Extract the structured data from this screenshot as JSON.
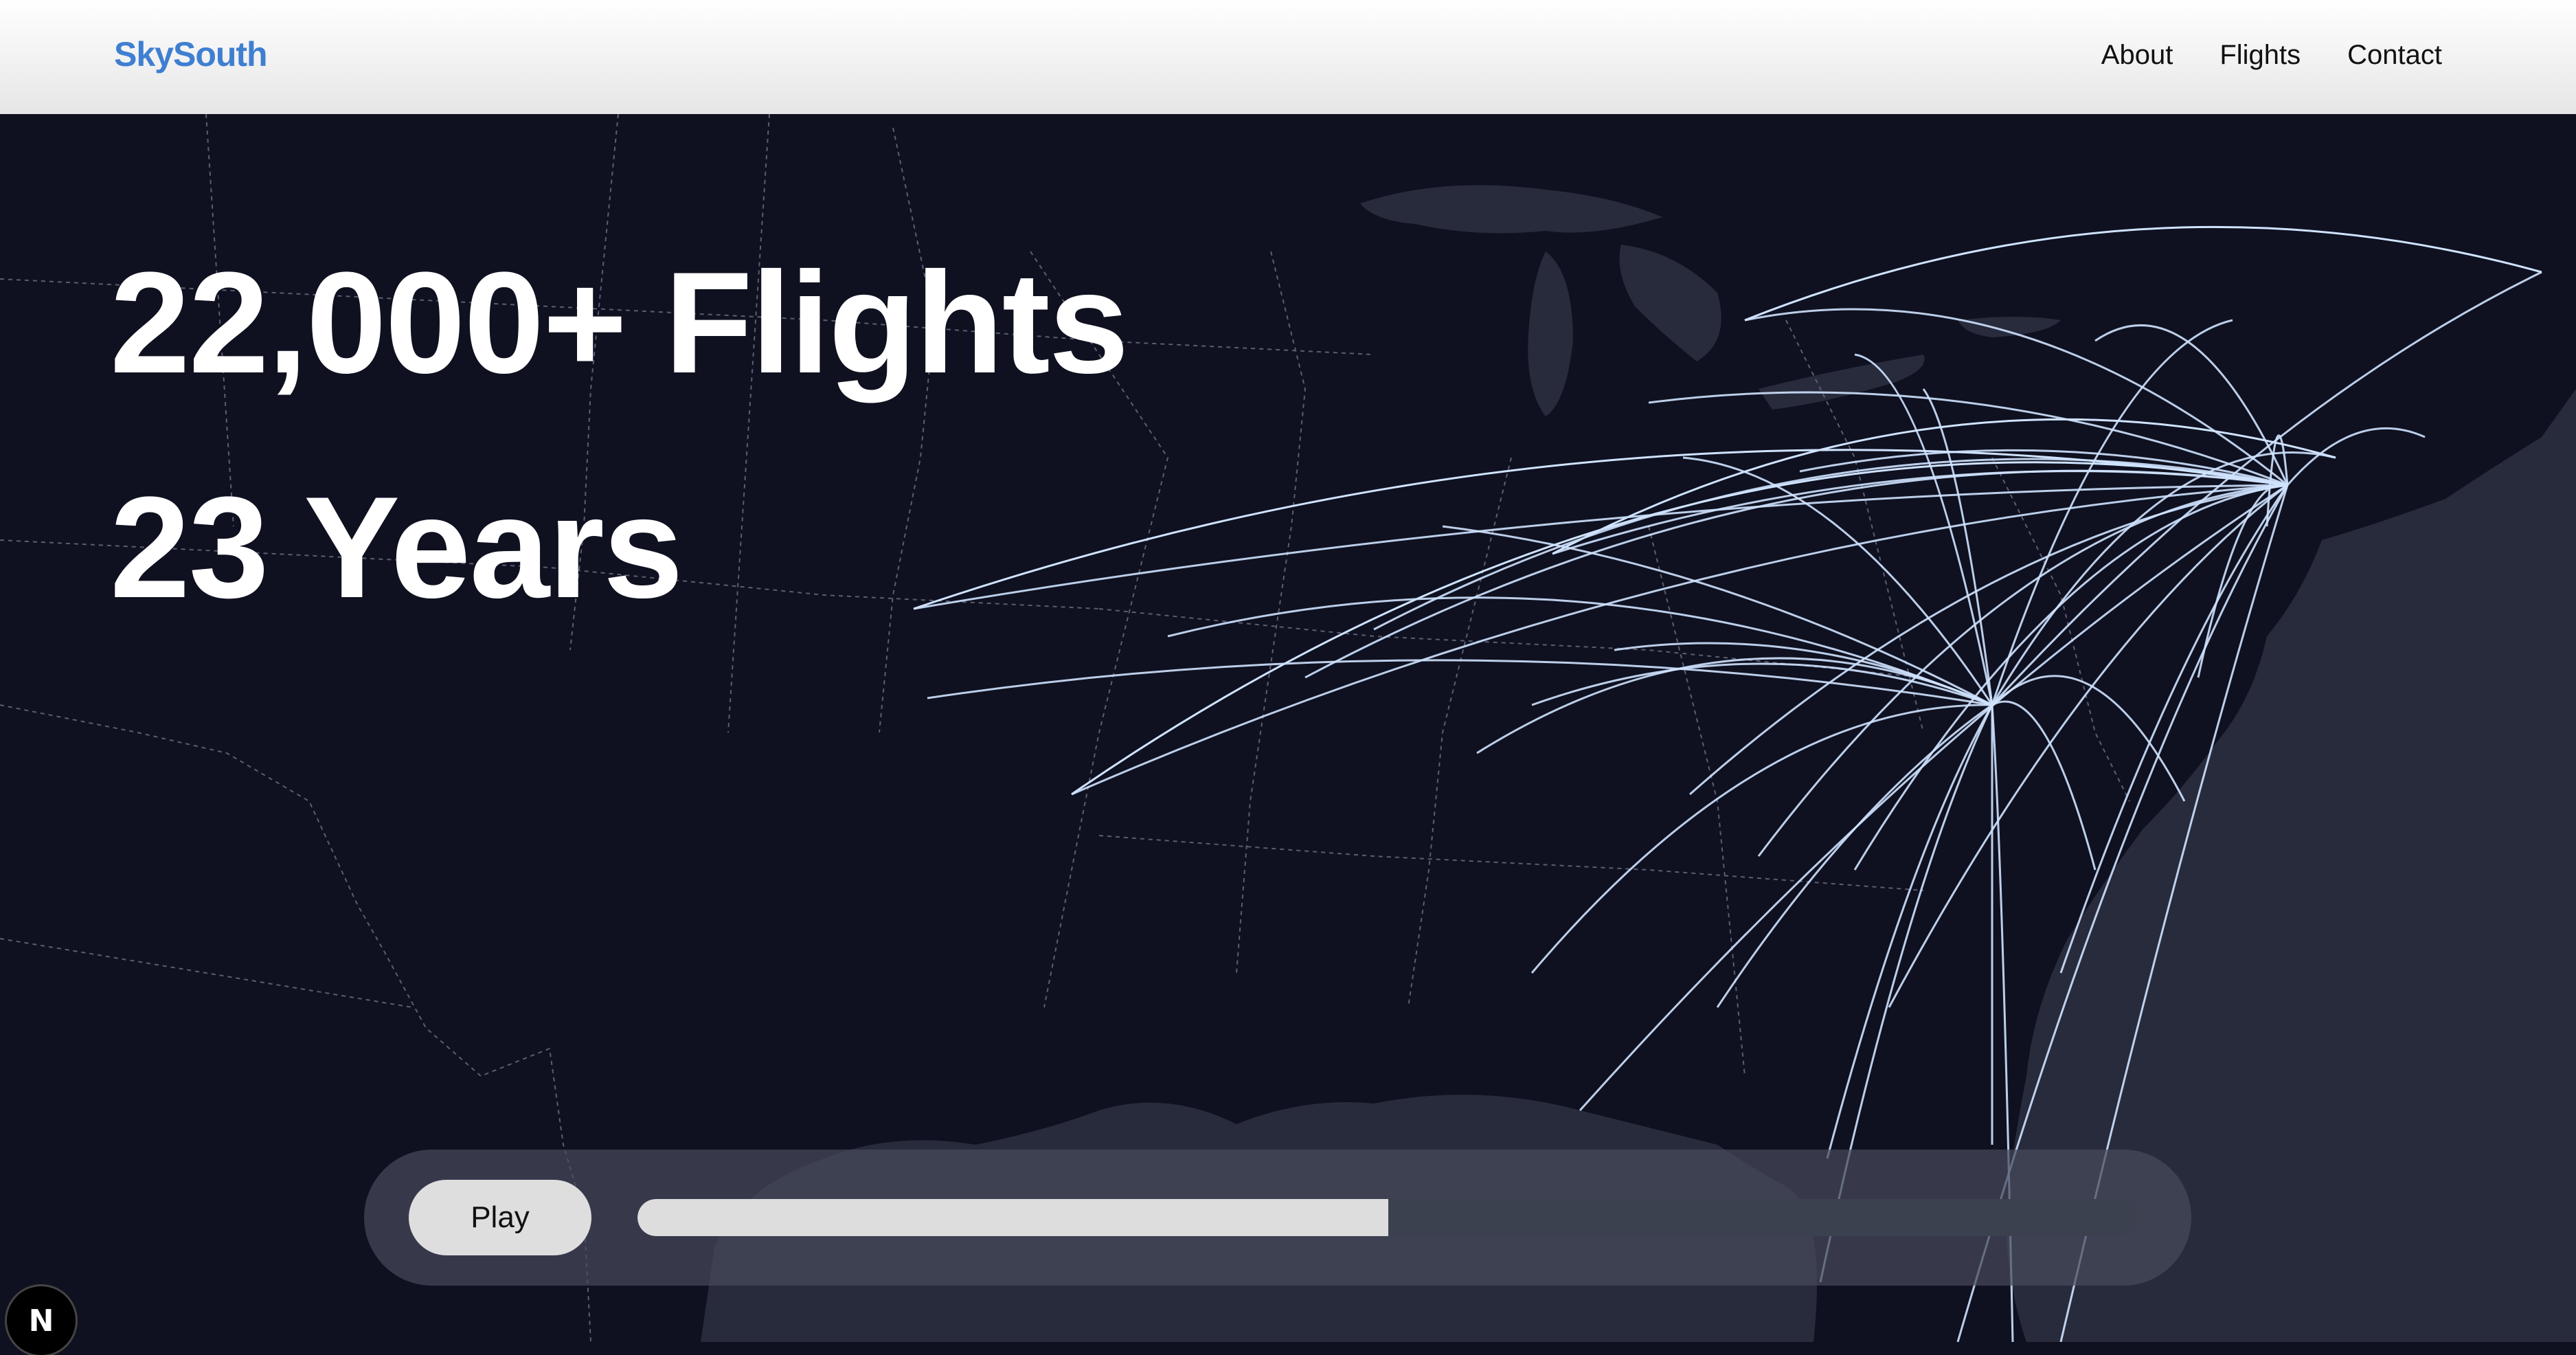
{
  "header": {
    "brand": "SkySouth",
    "brand_color": "#3f7fd1",
    "nav": [
      {
        "label": "About"
      },
      {
        "label": "Flights"
      },
      {
        "label": "Contact"
      }
    ]
  },
  "hero": {
    "flights_stat": "22,000+ Flights",
    "years_stat": "23 Years"
  },
  "player": {
    "play_label": "Play",
    "progress_percent": 50
  },
  "map": {
    "background_color": "#0f1120",
    "water_color": "#282b3c",
    "route_color": "#cfe3ff"
  },
  "badge": {
    "letter": "N",
    "icon": "nextjs-icon"
  }
}
